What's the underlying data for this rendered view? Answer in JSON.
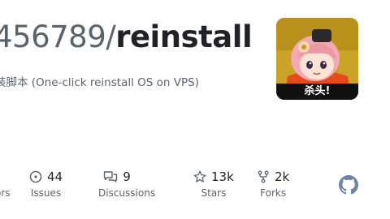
{
  "repo": {
    "owner": "456789",
    "separator": "/",
    "name": "reinstall",
    "description": "装脚本 (One-click reinstall OS on VPS)"
  },
  "avatar": {
    "caption": "杀头!",
    "icon": "avatar-anime-girl"
  },
  "stats": {
    "partial_label": "ors",
    "items": [
      {
        "icon": "issue-icon",
        "count": "44",
        "label": "Issues"
      },
      {
        "icon": "discussion-icon",
        "count": "9",
        "label": "Discussions"
      },
      {
        "icon": "star-icon",
        "count": "13k",
        "label": "Stars"
      },
      {
        "icon": "fork-icon",
        "count": "2k",
        "label": "Forks"
      }
    ]
  },
  "colors": {
    "title": "#1f2328",
    "muted": "#59636e",
    "github_icon": "#6e85a6",
    "avatar_bg": "#c9a227",
    "avatar_shirt": "#e84a1b"
  }
}
